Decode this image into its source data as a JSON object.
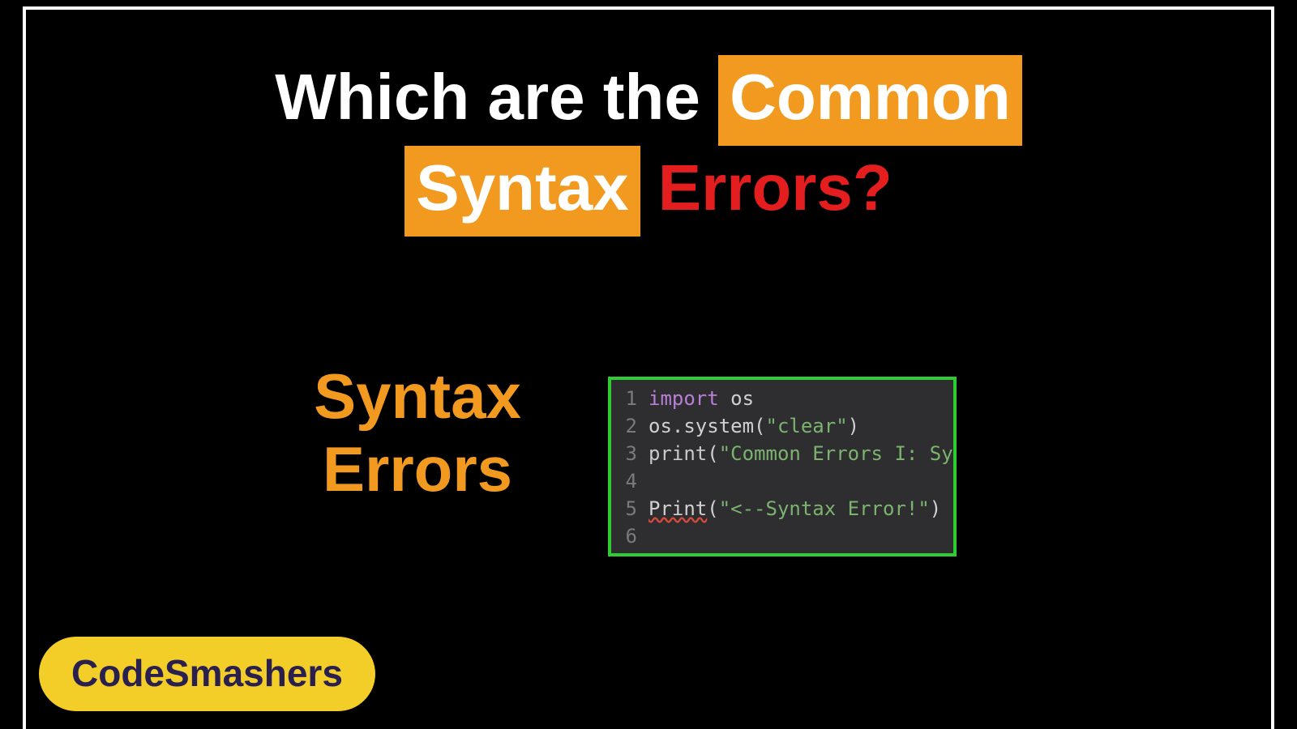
{
  "title": {
    "part1": "Which are the ",
    "highlight1": "Common",
    "highlight2": "Syntax",
    "part3": " Errors?"
  },
  "subtitle": {
    "line1": "Syntax",
    "line2": "Errors"
  },
  "code": {
    "lines": [
      {
        "num": "1",
        "tokens": [
          {
            "t": "kw",
            "v": "import"
          },
          {
            "t": "plain",
            "v": " os"
          }
        ]
      },
      {
        "num": "2",
        "tokens": [
          {
            "t": "plain",
            "v": "os.system("
          },
          {
            "t": "str",
            "v": "\"clear\""
          },
          {
            "t": "plain",
            "v": ")"
          }
        ]
      },
      {
        "num": "3",
        "tokens": [
          {
            "t": "fn",
            "v": "print"
          },
          {
            "t": "plain",
            "v": "("
          },
          {
            "t": "str",
            "v": "\"Common Errors I: Sy"
          }
        ]
      },
      {
        "num": "4",
        "tokens": []
      },
      {
        "num": "5",
        "tokens": [
          {
            "t": "squiggly",
            "v": "Print"
          },
          {
            "t": "plain",
            "v": "("
          },
          {
            "t": "str",
            "v": "\"<--Syntax Error!\""
          },
          {
            "t": "plain",
            "v": ")"
          }
        ]
      },
      {
        "num": "6",
        "tokens": []
      }
    ]
  },
  "badge": "CodeSmashers"
}
